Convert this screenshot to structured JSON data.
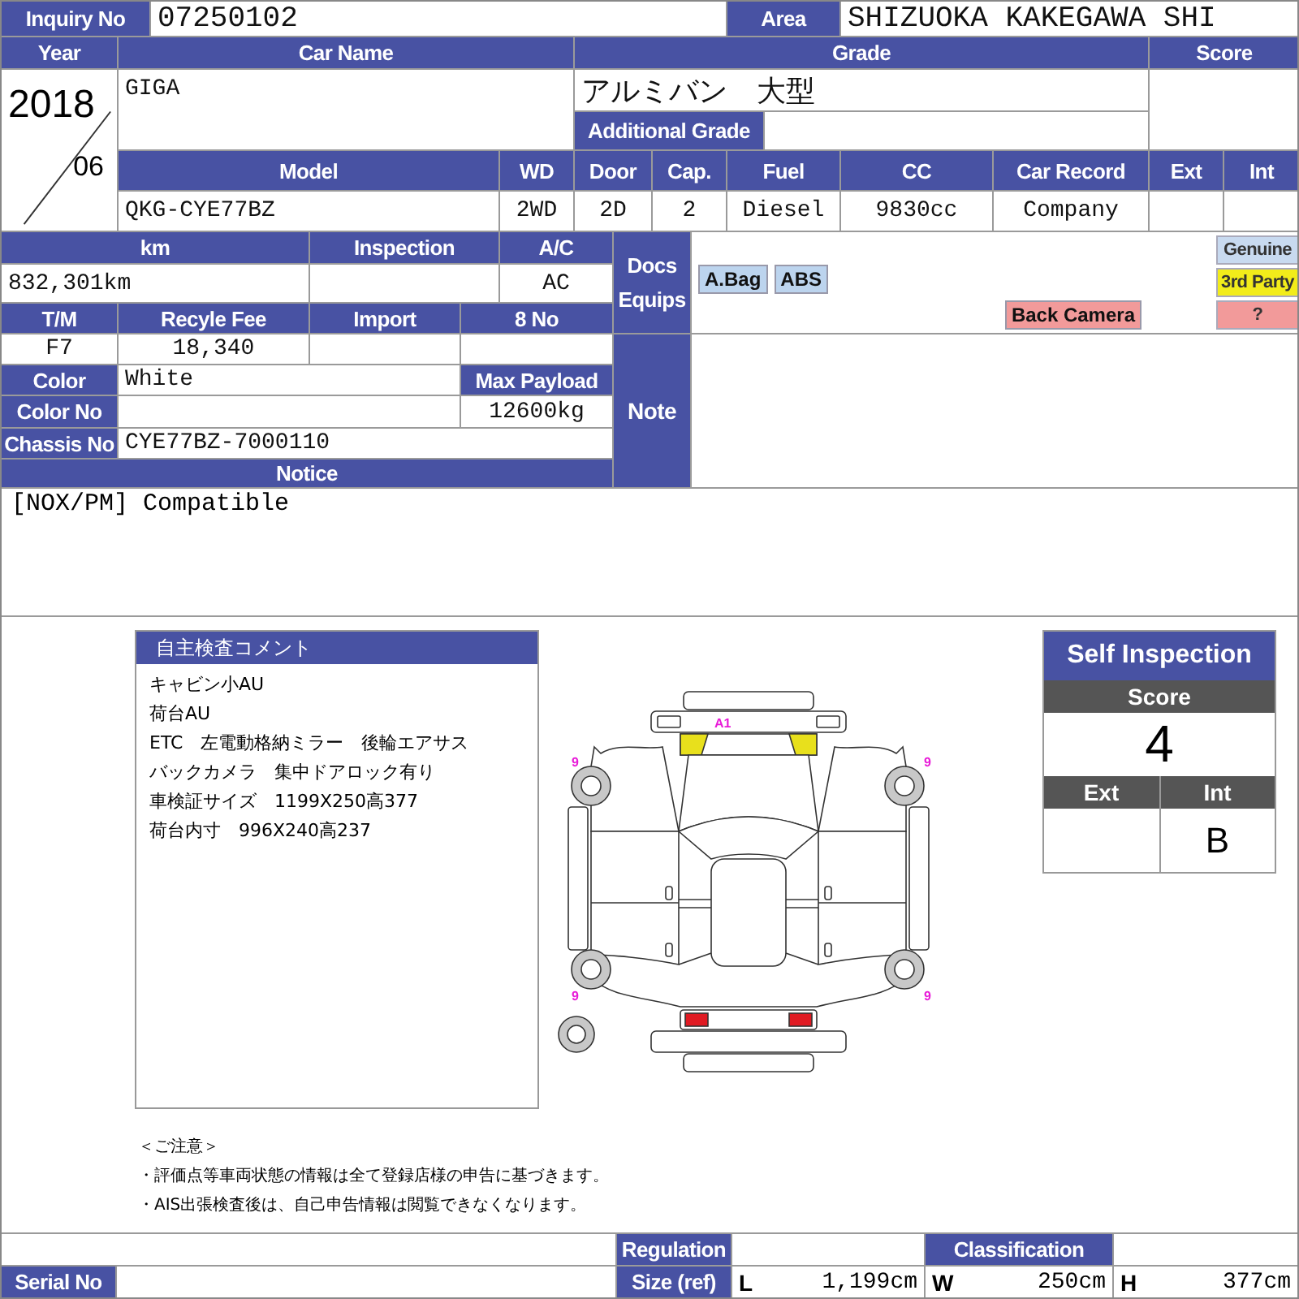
{
  "fields": {
    "inquiry_no": {
      "label": "Inquiry No",
      "value": "07250102"
    },
    "area": {
      "label": "Area",
      "value": "SHIZUOKA KAKEGAWA SHI"
    },
    "year": {
      "label": "Year",
      "value": "2018",
      "month": "06"
    },
    "car_name": {
      "label": "Car Name",
      "value": "GIGA"
    },
    "grade": {
      "label": "Grade",
      "value": "アルミバン　大型"
    },
    "score": {
      "label": "Score"
    },
    "additional_grade": {
      "label": "Additional Grade"
    },
    "model": {
      "label": "Model",
      "value": "QKG-CYE77BZ"
    },
    "wd": {
      "label": "WD",
      "value": "2WD"
    },
    "door": {
      "label": "Door",
      "value": "2D"
    },
    "cap": {
      "label": "Cap.",
      "value": "2"
    },
    "fuel": {
      "label": "Fuel",
      "value": "Diesel"
    },
    "cc": {
      "label": "CC",
      "value": "9830cc"
    },
    "car_record": {
      "label": "Car Record",
      "value": "Company"
    },
    "ext": {
      "label": "Ext"
    },
    "int": {
      "label": "Int"
    },
    "km": {
      "label": "km",
      "value": "832,301km"
    },
    "inspection": {
      "label": "Inspection"
    },
    "ac": {
      "label": "A/C",
      "value": "AC"
    },
    "tm": {
      "label": "T/M",
      "value": "F7"
    },
    "recycle_fee": {
      "label": "Recyle Fee",
      "value": "18,340"
    },
    "import": {
      "label": "Import"
    },
    "eight_no": {
      "label": "8 No"
    },
    "color": {
      "label": "Color",
      "value": "White"
    },
    "max_payload": {
      "label": "Max Payload",
      "value": "12600kg"
    },
    "color_no": {
      "label": "Color No"
    },
    "chassis_no": {
      "label": "Chassis No",
      "value": "CYE77BZ-7000110"
    },
    "notice": {
      "label": "Notice",
      "value": "[NOX/PM] Compatible"
    }
  },
  "docs_label": [
    "Docs",
    "Equips"
  ],
  "equipment": [
    {
      "label": "A.Bag",
      "color": "#bcd4ee"
    },
    {
      "label": "ABS",
      "color": "#bcd4ee"
    },
    {
      "label": "Back Camera",
      "color": "#f29a9a"
    }
  ],
  "legend": [
    {
      "label": "Genuine",
      "color": "#c8daf0"
    },
    {
      "label": "3rd Party",
      "color": "#f2ec1a"
    },
    {
      "label": "?",
      "color": "#f29a9a"
    }
  ],
  "note_label": "Note",
  "comment": {
    "title": "自主検査コメント",
    "lines": [
      "キャビン小AU",
      "荷台AU",
      "ETC　左電動格納ミラー　後輪エアサス",
      "バックカメラ　集中ドアロック有り",
      "車検証サイズ　1199X250高377",
      "荷台内寸　996X240高237"
    ]
  },
  "diagram_marks": [
    "A1",
    "9",
    "9",
    "9",
    "9"
  ],
  "self_inspection": {
    "title": "Self Inspection",
    "score_label": "Score",
    "score": "4",
    "ext_label": "Ext",
    "int_label": "Int",
    "int_value": "B"
  },
  "notes": {
    "heading": "＜ご注意＞",
    "lines": [
      "・評価点等車両状態の情報は全て登録店様の申告に基づきます。",
      "・AIS出張検査後は、自己申告情報は閲覧できなくなります。"
    ]
  },
  "bottom": {
    "regulation_label": "Regulation",
    "classification_label": "Classification",
    "serial_no_label": "Serial No",
    "size_label": "Size (ref)",
    "sizes": [
      {
        "label": "L",
        "value": "1,199cm"
      },
      {
        "label": "W",
        "value": "250cm"
      },
      {
        "label": "H",
        "value": "377cm"
      }
    ]
  }
}
